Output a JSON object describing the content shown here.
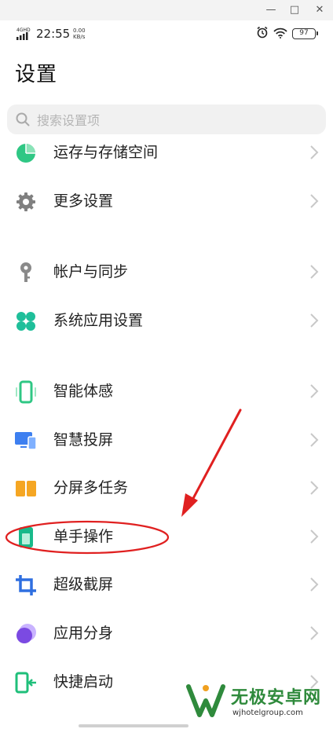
{
  "status_bar": {
    "network": "4GHD",
    "time": "22:55",
    "speed_value": "0.00",
    "speed_unit": "KB/s",
    "battery": "97"
  },
  "page": {
    "title": "设置"
  },
  "search": {
    "placeholder": "搜索设置项"
  },
  "settings": [
    {
      "label": "运存与存储空间",
      "icon": "storage-pie-icon",
      "color": "#2fc784"
    },
    {
      "label": "更多设置",
      "icon": "gear-icon",
      "color": "#808080"
    },
    {
      "label": "帐户与同步",
      "icon": "key-icon",
      "color": "#8a8a8a"
    },
    {
      "label": "系统应用设置",
      "icon": "clover-icon",
      "color": "#1fbf9a"
    },
    {
      "label": "智能体感",
      "icon": "phone-motion-icon",
      "color": "#2fc784"
    },
    {
      "label": "智慧投屏",
      "icon": "screen-cast-icon",
      "color": "#3d7ff0"
    },
    {
      "label": "分屏多任务",
      "icon": "split-screen-icon",
      "color": "#f5a623"
    },
    {
      "label": "单手操作",
      "icon": "one-hand-icon",
      "color": "#18b98a"
    },
    {
      "label": "超级截屏",
      "icon": "crop-icon",
      "color": "#2f6fe0"
    },
    {
      "label": "应用分身",
      "icon": "app-clone-icon",
      "color": "#7b4ae2"
    },
    {
      "label": "快捷启动",
      "icon": "quick-launch-icon",
      "color": "#1fbf7a"
    }
  ],
  "watermark": {
    "name": "无极安卓网",
    "url": "wjhotelgroup.com"
  },
  "colors": {
    "annotation": "#e02020",
    "chevron": "#c8c8c8"
  }
}
